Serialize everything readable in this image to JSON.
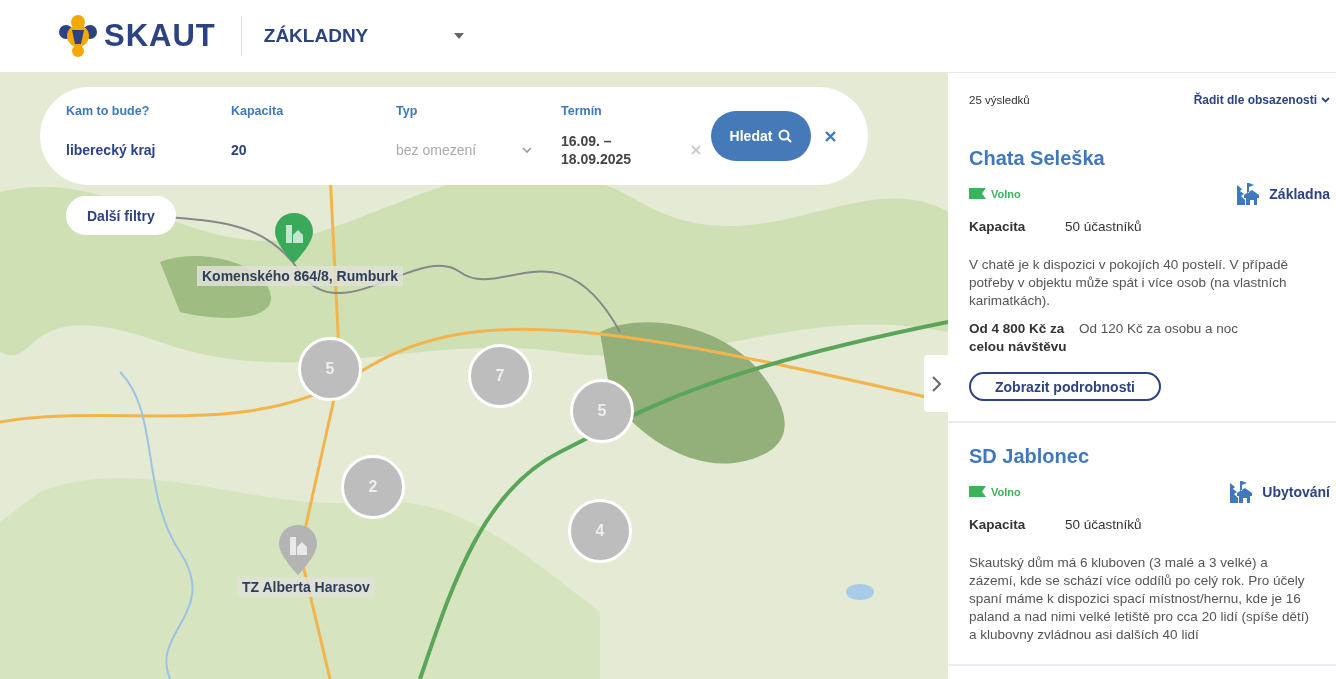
{
  "header": {
    "logo": "SKAUT",
    "section": "ZÁKLADNY"
  },
  "search": {
    "fields": [
      {
        "kind": "text",
        "label": "Kam to bude?",
        "value": "liberecký kraj"
      },
      {
        "kind": "text",
        "label": "Kapacita",
        "value": "20"
      },
      {
        "kind": "select",
        "label": "Typ",
        "placeholder": "bez omezení"
      },
      {
        "kind": "date",
        "label": "Termín",
        "value": "16.09. – 18.09.2025"
      }
    ],
    "button": "Hledat"
  },
  "more_filters": "Další filtry",
  "map": {
    "clusters": [
      {
        "count": "5"
      },
      {
        "count": "7"
      },
      {
        "count": "5"
      },
      {
        "count": "2"
      },
      {
        "count": "4"
      }
    ],
    "markers": [
      {
        "label": "Komenského 864/8, Rumburk",
        "color": "#3aaa5a"
      },
      {
        "label": "TZ Alberta Harasov",
        "color": "#b4b4b4"
      }
    ]
  },
  "results": {
    "count": "25 výsledků",
    "sort": "Řadit dle obsazenosti",
    "items": [
      {
        "title": "Chata Seleška",
        "status": "Volno",
        "type": "Základna",
        "capacity_label": "Kapacita",
        "capacity": "50 účastníků",
        "description": "V chatě je k dispozici v pokojích 40 postelí. V případě potřeby v objektu může spát i více osob (na vlastních karimatkách).",
        "price_total": "Od 4 800 Kč za celou návštěvu",
        "price_person": "Od 120 Kč za osobu a noc",
        "details": "Zobrazit podrobnosti"
      },
      {
        "title": "SD Jablonec",
        "status": "Volno",
        "type": "Ubytování",
        "capacity_label": "Kapacita",
        "capacity": "50 účastníků",
        "description": "Skautský dům má 6 kluboven (3 malé a 3 velké) a zázemí, kde se schází více oddílů po celý rok. Pro účely spaní máme k dispozici spací místnost/hernu, kde je 16 paland a nad nimi velké letiště pro cca 20 lidí (spíše dětí) a klubovny zvládnou asi dalších 40 lidí"
      }
    ]
  }
}
